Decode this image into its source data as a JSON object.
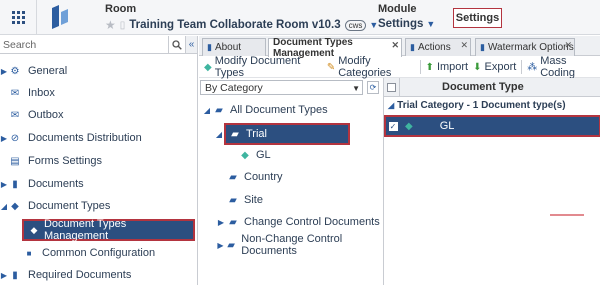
{
  "header": {
    "room_label": "Room",
    "room_name": "Training Team Collaborate Room v10.3",
    "room_badge": "cws",
    "module_label": "Module",
    "module_value": "Settings",
    "breadcrumb_current": "Settings"
  },
  "sidebar": {
    "search_placeholder": "Search",
    "items": [
      {
        "label": "General"
      },
      {
        "label": "Inbox"
      },
      {
        "label": "Outbox"
      },
      {
        "label": "Documents Distribution"
      },
      {
        "label": "Forms Settings"
      },
      {
        "label": "Documents"
      },
      {
        "label": "Document Types"
      },
      {
        "label": "Document Types Management"
      },
      {
        "label": "Common Configuration"
      },
      {
        "label": "Required Documents"
      }
    ]
  },
  "tabs": [
    {
      "label": "About"
    },
    {
      "label": "Document Types Management"
    },
    {
      "label": "Actions"
    },
    {
      "label": "Watermark Options"
    }
  ],
  "toolbar": {
    "modify_doc_types": "Modify Document Types",
    "modify_categories": "Modify Categories",
    "import": "Import",
    "export": "Export",
    "mass_coding": "Mass Coding"
  },
  "tree": {
    "select_value": "By Category",
    "root": "All Document Types",
    "nodes": [
      {
        "label": "Trial"
      },
      {
        "label": "GL"
      },
      {
        "label": "Country"
      },
      {
        "label": "Site"
      },
      {
        "label": "Change Control Documents"
      },
      {
        "label": "Non-Change Control Documents"
      }
    ]
  },
  "grid": {
    "column": "Document Type",
    "group": "Trial Category - 1 Document type(s)",
    "rows": [
      {
        "value": "GL"
      }
    ]
  },
  "colors": {
    "selected_bg": "#2c4f80",
    "highlight_border": "#b3343f",
    "accent": "#2c5da0"
  }
}
